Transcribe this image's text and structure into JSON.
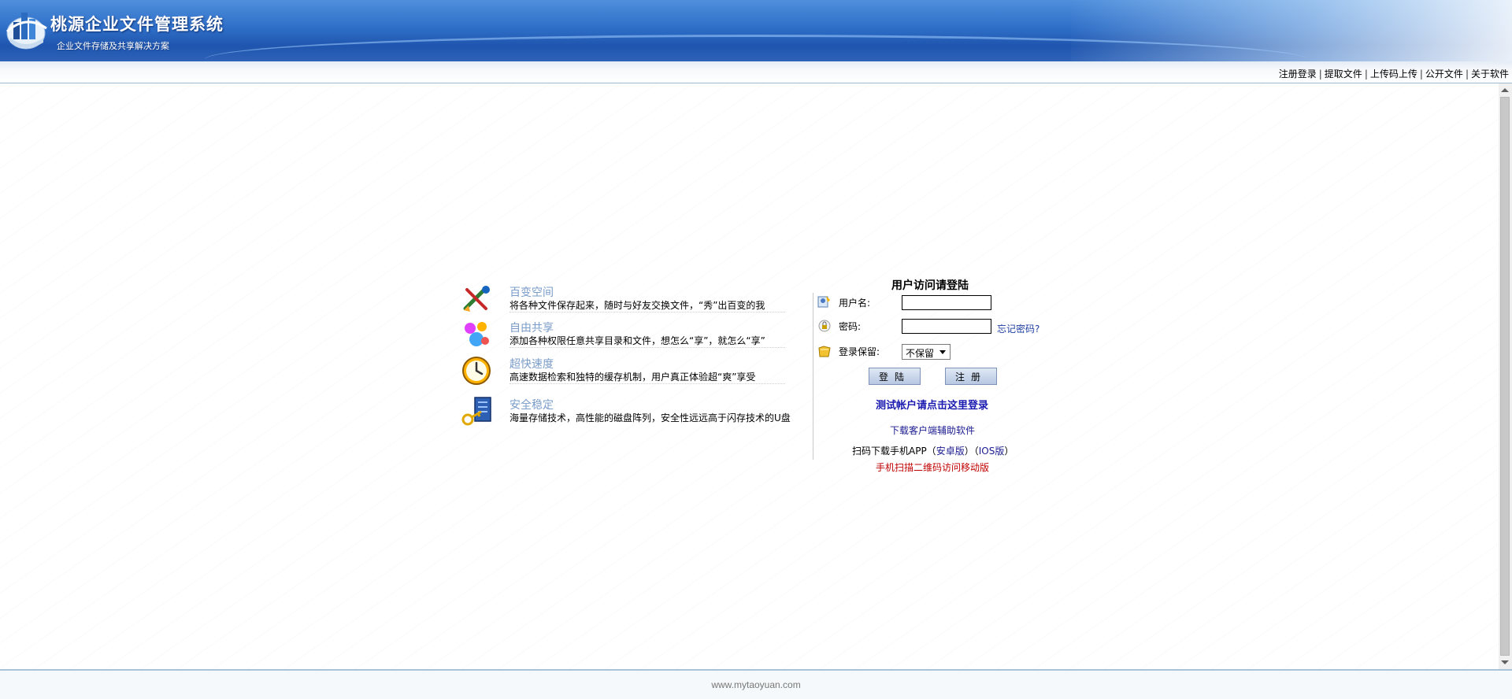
{
  "header": {
    "title": "桃源企业文件管理系统",
    "subtitle": "企业文件存储及共享解决方案"
  },
  "topnav": {
    "links": [
      "注册登录",
      "提取文件",
      "上传码上传",
      "公开文件",
      "关于软件"
    ],
    "separator": "|"
  },
  "features": [
    {
      "title": "百变空间",
      "desc": "将各种文件保存起来，随时与好友交换文件，“秀”出百变的我",
      "icon": "tools-icon"
    },
    {
      "title": "自由共享",
      "desc": "添加各种权限任意共享目录和文件，想怎么“享”，就怎么“享”",
      "icon": "people-icon"
    },
    {
      "title": "超快速度",
      "desc": "高速数据检索和独特的缓存机制，用户真正体验超“爽”享受",
      "icon": "clock-icon"
    },
    {
      "title": "安全稳定",
      "desc": "海量存储技术，高性能的磁盘阵列，安全性远远高于闪存技术的U盘",
      "icon": "key-icon"
    }
  ],
  "login": {
    "title": "用户访问请登陆",
    "username_label": "用户名:",
    "username_value": "",
    "password_label": "密码:",
    "password_value": "",
    "forgot_password": "忘记密码?",
    "remember_label": "登录保留:",
    "remember_selected": "不保留",
    "login_button": "登陆",
    "register_button": "注册",
    "test_account_link": "测试帐户请点击这里登录",
    "download_client": "下载客户端辅助软件",
    "scan_app_prefix": "扫码下载手机APP（",
    "scan_app_android": "安卓版",
    "scan_app_middle": "）（",
    "scan_app_ios": "IOS版",
    "scan_app_suffix": "）",
    "qr_mobile": "手机扫描二维码访问移动版"
  },
  "footer": {
    "url": "www.mytaoyuan.com"
  },
  "colors": {
    "header_blue": "#2f6fc8",
    "feature_title": "#7a9cc8",
    "link_blue": "#1a1a90",
    "qr_red": "#c00000"
  }
}
